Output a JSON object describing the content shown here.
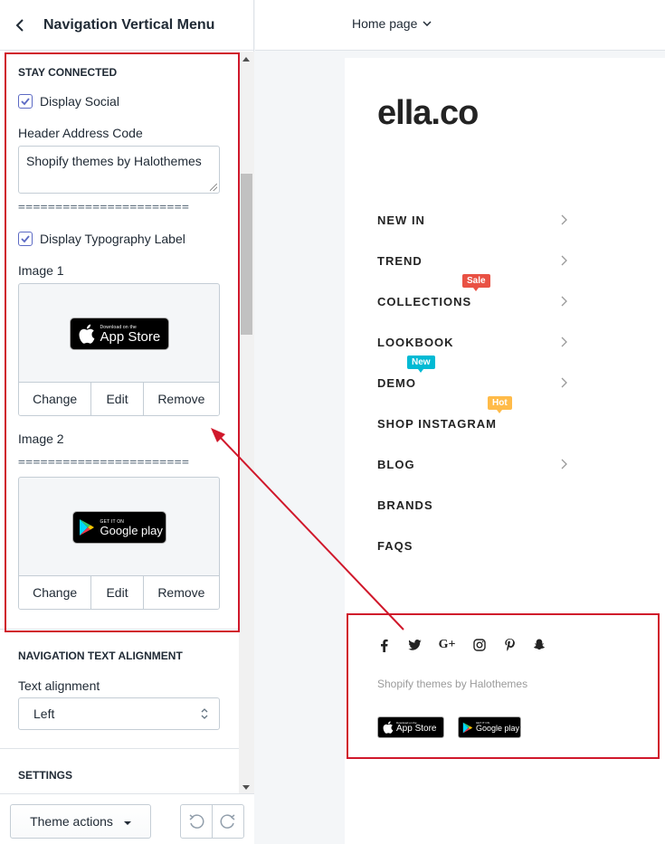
{
  "sidebar": {
    "title": "Navigation Vertical Menu",
    "stay_connected": {
      "heading": "STAY CONNECTED",
      "display_social_label": "Display Social",
      "display_social_checked": true,
      "header_address_label": "Header Address Code",
      "header_address_value": "Shopify themes by Halothemes",
      "divider": "=======================",
      "display_typography_label": "Display Typography Label",
      "display_typography_checked": true,
      "image1_label": "Image 1",
      "image2_label": "Image 2",
      "image_actions": {
        "change": "Change",
        "edit": "Edit",
        "remove": "Remove"
      }
    },
    "nav_alignment": {
      "heading": "NAVIGATION TEXT ALIGNMENT",
      "label": "Text alignment",
      "value": "Left"
    },
    "settings_heading": "SETTINGS",
    "footer": {
      "theme_actions": "Theme actions"
    }
  },
  "topbar": {
    "page_select": "Home page"
  },
  "app_store": {
    "small": "Download on the",
    "big": "App Store"
  },
  "google_play": {
    "small": "GET IT ON",
    "big": "Google play"
  },
  "preview": {
    "logo": "ella.co",
    "menu": [
      {
        "label": "NEW IN",
        "chevron": true,
        "badge": null
      },
      {
        "label": "TREND",
        "chevron": true,
        "badge": null
      },
      {
        "label": "COLLECTIONS",
        "chevron": true,
        "badge": "Sale",
        "badge_color": "#e95144"
      },
      {
        "label": "LOOKBOOK",
        "chevron": true,
        "badge": null
      },
      {
        "label": "DEMO",
        "chevron": true,
        "badge": "New",
        "badge_color": "#01bad4"
      },
      {
        "label": "SHOP INSTAGRAM",
        "chevron": false,
        "badge": "Hot",
        "badge_color": "#ffbb49"
      },
      {
        "label": "BLOG",
        "chevron": true,
        "badge": null
      },
      {
        "label": "BRANDS",
        "chevron": false,
        "badge": null
      },
      {
        "label": "FAQS",
        "chevron": false,
        "badge": null
      }
    ],
    "social_icons": [
      "facebook-icon",
      "twitter-icon",
      "google-plus-icon",
      "instagram-icon",
      "pinterest-icon",
      "snapchat-icon"
    ],
    "address": "Shopify themes by Halothemes"
  },
  "colors": {
    "highlight": "#d0182b",
    "accent": "#5c6ac4"
  }
}
